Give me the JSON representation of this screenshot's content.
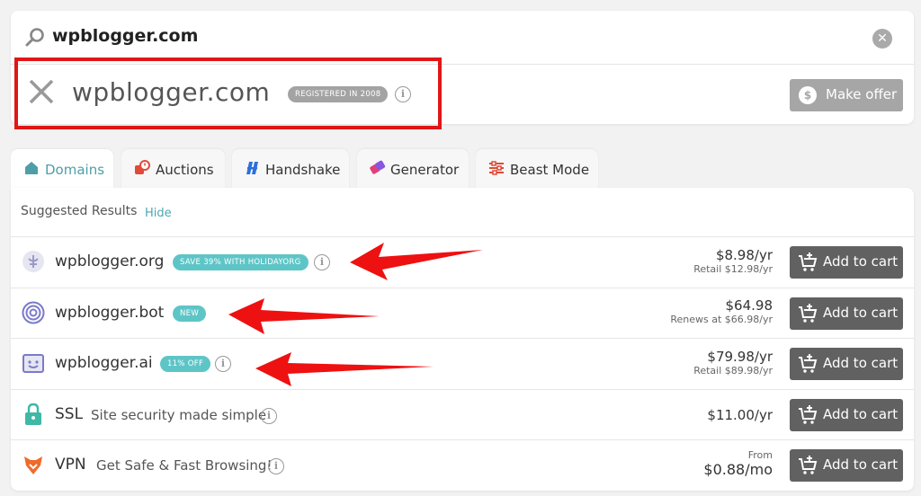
{
  "search": {
    "query": "wpblogger.com"
  },
  "result": {
    "domain": "wpblogger.com",
    "badge": "REGISTERED IN 2008",
    "make_offer_label": "Make offer",
    "offer_icon_glyph": "$"
  },
  "tabs": [
    {
      "label": "Domains",
      "icon": "home-icon"
    },
    {
      "label": "Auctions",
      "icon": "auction-icon"
    },
    {
      "label": "Handshake",
      "icon": "handshake-icon"
    },
    {
      "label": "Generator",
      "icon": "generator-icon"
    },
    {
      "label": "Beast Mode",
      "icon": "sliders-icon"
    }
  ],
  "suggested": {
    "title": "Suggested Results",
    "hide_label": "Hide"
  },
  "rows": [
    {
      "name": "wpblogger.org",
      "badge": "SAVE 39% WITH HOLIDAYORG",
      "price": "$8.98/yr",
      "sub": "Retail $12.98/yr",
      "button": "Add to cart"
    },
    {
      "name": "wpblogger.bot",
      "badge": "NEW",
      "price": "$64.98",
      "sub": "Renews at $66.98/yr",
      "button": "Add to cart"
    },
    {
      "name": "wpblogger.ai",
      "badge": "11% OFF",
      "price": "$79.98/yr",
      "sub": "Retail $89.98/yr",
      "button": "Add to cart"
    },
    {
      "name": "SSL",
      "desc": "Site security made simple",
      "price": "$11.00/yr",
      "button": "Add to cart"
    },
    {
      "name": "VPN",
      "desc": "Get Safe & Fast Browsing!",
      "from": "From",
      "price": "$0.88/mo",
      "button": "Add to cart"
    }
  ],
  "colors": {
    "accent": "#4e9ea8",
    "badge_teal": "#5ec5c7",
    "button_dark": "#616161",
    "annotation_red": "#e01616"
  }
}
